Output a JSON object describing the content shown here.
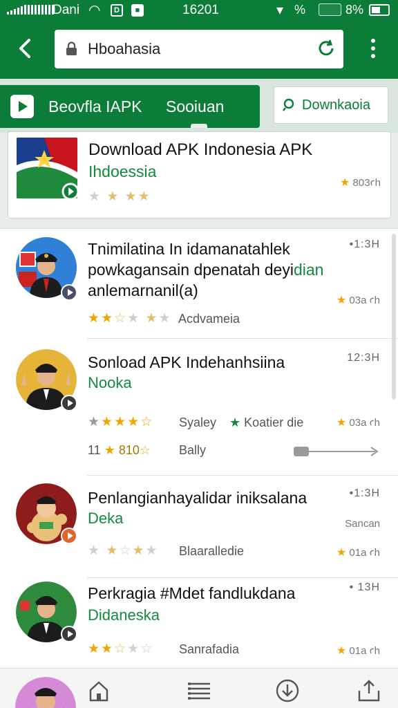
{
  "status_bar": {
    "carrier": "Dani",
    "box_left": "D",
    "time": "16201",
    "percent_small": "%",
    "percent": "8%"
  },
  "app_bar": {
    "url": "Hboahasia"
  },
  "tabs": {
    "active_label_1": "Beovfla IAPK",
    "active_label_2": "Sooiuan",
    "download_button": "Downkaoia"
  },
  "top_card": {
    "title": "Download APK Indonesia APK",
    "subtitle": "Ihdoessia",
    "rating": "80",
    "rating_suffix": "3ꜥh",
    "stars": 3
  },
  "items": [
    {
      "title_line1": "Tnimilatina In idamanatahlek",
      "title_line2_black": "powkagansain dpenatah deyi",
      "title_line2_green": "dian",
      "title_line3": "anlemarnanil(a)",
      "time": "•1:3H",
      "rating": "03",
      "rating_suffix": "a ꜥh",
      "stars": 2,
      "meta": "Acdvameia",
      "badge_color": "#4a4f6a"
    },
    {
      "title": "Sonload APK Indehanhsiina",
      "subtitle": "Nooka",
      "time": "12:3H",
      "rating": "03",
      "rating_suffix": "a ꜥh",
      "stars": 4,
      "meta_1": "Syaley",
      "meta_2": "Koatier die",
      "extra_count": "11",
      "extra_value": "810",
      "extra_label": "Bally",
      "badge_color": "#3a3a3a"
    },
    {
      "title": "Penlangianhayalidar iniksalana",
      "subtitle": "Deka",
      "time": "•1:3H",
      "right_label": "Sancan",
      "rating": "01",
      "rating_suffix": "a ꜥh",
      "stars": 1,
      "meta": "Blaaralledie",
      "badge_color": "#e0652a"
    },
    {
      "title": "Perkragia #Mdet fandlukdana",
      "subtitle": "Didaneska",
      "time": "• 13H",
      "rating": "01",
      "rating_suffix": "a ꜥh",
      "stars": 2,
      "meta": "Sanrafadia",
      "badge_color": "#3a3a3a"
    }
  ],
  "icons": {
    "back": "back-arrow-icon",
    "lock": "lock-icon",
    "reload": "reload-icon",
    "menu": "kebab-menu-icon",
    "play": "play-store-icon",
    "home": "home-icon",
    "list": "list-icon",
    "download": "download-icon",
    "share": "share-icon"
  },
  "colors": {
    "primary": "#0c7c39",
    "accent_text": "#128a3e",
    "star": "#f0a500"
  }
}
